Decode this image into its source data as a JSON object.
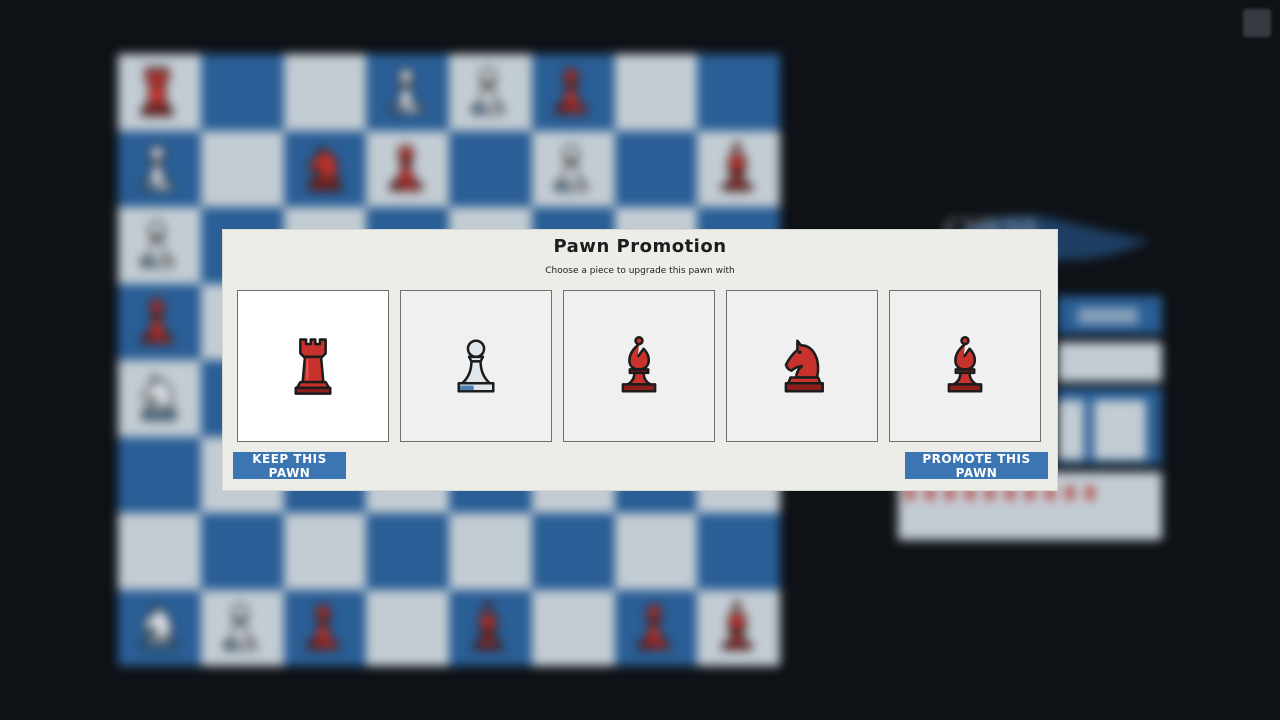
{
  "modal": {
    "title": "Pawn Promotion",
    "subtitle": "Choose a piece to upgrade this pawn with",
    "choices": [
      {
        "piece": "rook",
        "color": "red",
        "selected": true
      },
      {
        "piece": "pawn",
        "color": "white",
        "selected": false
      },
      {
        "piece": "bishop",
        "color": "red",
        "selected": false
      },
      {
        "piece": "knight",
        "color": "red",
        "selected": false
      },
      {
        "piece": "bishop",
        "color": "red",
        "selected": false
      }
    ],
    "keep_label": "KEEP THIS PAWN",
    "promote_label": "PROMOTE THIS PAWN"
  },
  "theme": {
    "accent": "#3b76b3",
    "red_piece": "#c8322c",
    "white_piece": "#dfe6ec",
    "board_light": "#c3ccd3",
    "board_dark": "#2a5e96",
    "modal_bg": "#ecece8"
  },
  "icons": {
    "settings": "gear-icon"
  }
}
